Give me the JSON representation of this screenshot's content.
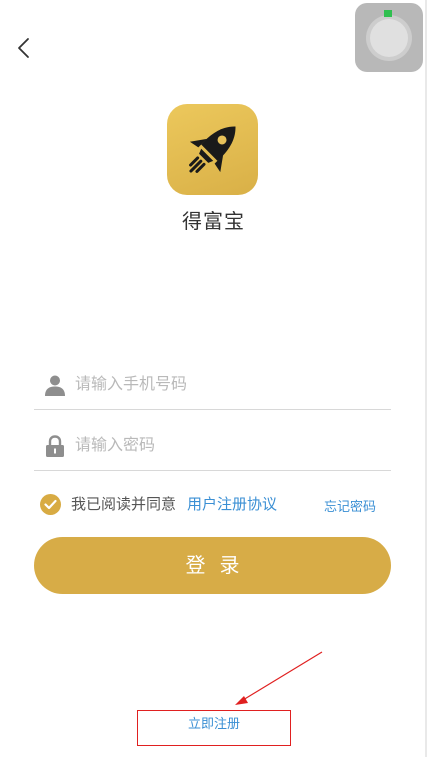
{
  "header": {
    "back_icon": "chevron-left-icon",
    "float_button_icon": "assistive-touch-icon"
  },
  "app": {
    "logo_icon": "rocket-icon",
    "name": "得富宝",
    "brand_color": "#d7ac47"
  },
  "form": {
    "phone": {
      "icon": "user-icon",
      "placeholder": "请输入手机号码",
      "value": ""
    },
    "password": {
      "icon": "lock-icon",
      "placeholder": "请输入密码",
      "value": ""
    },
    "agreement": {
      "checked": true,
      "text": "我已阅读并同意",
      "link_label": "用户注册协议"
    },
    "forgot_password_label": "忘记密码",
    "login_label": "登录"
  },
  "footer": {
    "register_label": "立即注册"
  },
  "colors": {
    "link": "#3a8fd4",
    "annotation": "#e02020",
    "divider": "#d8d8d8"
  }
}
